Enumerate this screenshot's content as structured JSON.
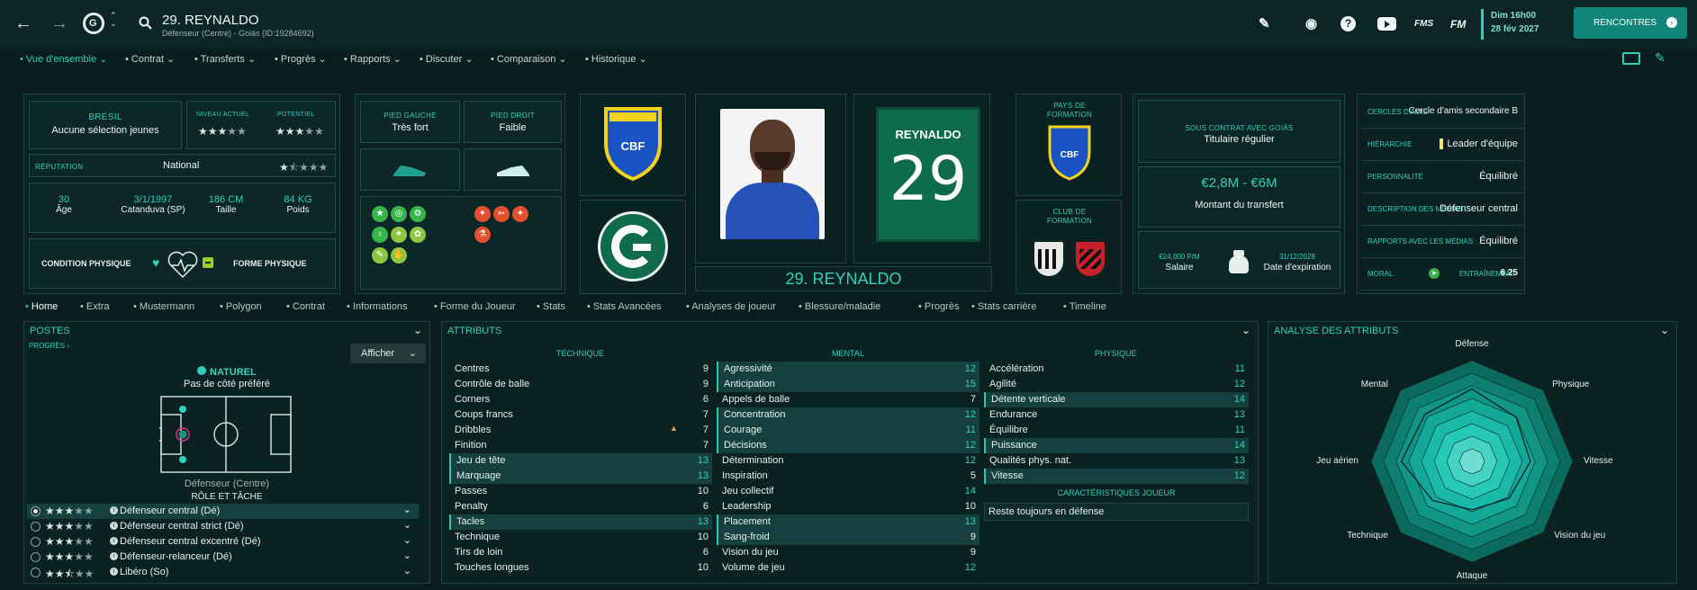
{
  "header": {
    "player_name": "29. REYNALDO",
    "subtitle": "Défenseur (Centre) - Goiás (ID:19284692)",
    "icons": [
      "back-arrow-icon",
      "forward-arrow-icon",
      "club-badge-icon",
      "search-icon",
      "edit-pencil-icon",
      "brain-icon",
      "help-icon",
      "youtube-icon",
      "fms-icon",
      "fm-icon"
    ],
    "fms_label": "FMS",
    "fm_label": "FM",
    "date_line1": "Dim 16h00",
    "date_line2": "28 fév 2027",
    "rencontres_label": "RENCONTRES"
  },
  "subnav": [
    "Vue d'ensemble",
    "Contrat",
    "Transferts",
    "Progrès",
    "Rapports",
    "Discuter",
    "Comparaison",
    "Historique"
  ],
  "overview": {
    "nation": "BRÉSIL",
    "nation_sub": "Aucune sélection jeunes",
    "niveau_label": "NIVEAU ACTUEL",
    "potentiel_label": "POTENTIEL",
    "niveau_stars": 3,
    "potentiel_stars": 3,
    "reputation_label": "RÉPUTATION",
    "reputation_value": "National",
    "reputation_stars": 1.5,
    "age": "30",
    "age_label": "Âge",
    "birth": "3/1/1997",
    "birth_label": "Catanduva (SP)",
    "height": "186 CM",
    "height_label": "Taille",
    "weight": "84 KG",
    "weight_label": "Poids",
    "condition_label": "CONDITION PHYSIQUE",
    "forme_label": "FORME PHYSIQUE",
    "pied_gauche_label": "PIED GAUCHE",
    "pied_gauche_value": "Très fort",
    "pied_droit_label": "PIED DROIT",
    "pied_droit_value": "Faible",
    "shirt_name": "REYNALDO",
    "shirt_number": "29",
    "banner_name": "29. REYNALDO",
    "cbf_label": "CBF",
    "pays_formation_label": "PAYS DE FORMATION",
    "club_formation_label": "CLUB DE FORMATION",
    "contract_label": "SOUS CONTRAT AVEC GOIÁS",
    "contract_value": "Titulaire régulier",
    "transfer_value": "€2,8M - €6M",
    "transfer_label": "Montant du transfert",
    "salary": "€24,000 P/M",
    "salary_label": "Salaire",
    "expiry": "31/12/2028",
    "expiry_label": "Date d'expiration"
  },
  "right_info": [
    {
      "k": "CERCLES D'AMIS",
      "v": "Cercle d'amis secondaire B"
    },
    {
      "k": "HIÉRARCHIE",
      "v": "Leader d'équipe"
    },
    {
      "k": "PERSONNALITÉ",
      "v": "Équilibré"
    },
    {
      "k": "DESCRIPTION DES MÉDIAS",
      "v": "Défenseur central"
    },
    {
      "k": "RAPPORTS AVEC LES MÉDIAS",
      "v": "Équilibré"
    },
    {
      "k": "MORAL",
      "v": ""
    }
  ],
  "moral_extra": {
    "k": "ENTRAÎNEMENT",
    "v": "6.25"
  },
  "tabs": [
    "Home",
    "Extra",
    "Mustermann",
    "Polygon",
    "Contrat",
    "Informations",
    "Forme du Joueur",
    "Stats",
    "Stats Avancées",
    "Analyses de joueur",
    "Blessure/maladie",
    "Progrès",
    "Stats carrière",
    "Timeline"
  ],
  "positions": {
    "title": "POSTES",
    "progres_link": "PROGRÈS",
    "afficher_label": "Afficher",
    "natural_label": "NATUREL",
    "side_label": "Pas de côté préféré",
    "position_label": "Défenseur (Centre)",
    "role_label": "RÔLE ET TÂCHE",
    "roles": [
      {
        "name": "Défenseur central (Dé)",
        "stars": 3
      },
      {
        "name": "Défenseur central strict (Dé)",
        "stars": 3
      },
      {
        "name": "Défenseur central excentré (Dé)",
        "stars": 3
      },
      {
        "name": "Défenseur-relanceur (Dé)",
        "stars": 3
      },
      {
        "name": "Libéro (So)",
        "stars": 2.5
      }
    ]
  },
  "attributes": {
    "title": "ATTRIBUTS",
    "technique_label": "TECHNIQUE",
    "mental_label": "MENTAL",
    "physique_label": "PHYSIQUE",
    "traits_label": "CARACTÉRISTIQUES JOUEUR",
    "trait": "Reste toujours en défense",
    "technique": [
      {
        "n": "Centres",
        "v": "9",
        "hl": false
      },
      {
        "n": "Contrôle de balle",
        "v": "9",
        "hl": false
      },
      {
        "n": "Corners",
        "v": "6",
        "hl": false
      },
      {
        "n": "Coups francs",
        "v": "7",
        "hl": false
      },
      {
        "n": "Dribbles",
        "v": "7",
        "hl": false
      },
      {
        "n": "Finition",
        "v": "7",
        "hl": false
      },
      {
        "n": "Jeu de tête",
        "v": "13",
        "hl": true
      },
      {
        "n": "Marquage",
        "v": "13",
        "hl": true
      },
      {
        "n": "Passes",
        "v": "10",
        "hl": false
      },
      {
        "n": "Penalty",
        "v": "6",
        "hl": false
      },
      {
        "n": "Tacles",
        "v": "13",
        "hl": true
      },
      {
        "n": "Technique",
        "v": "10",
        "hl": false
      },
      {
        "n": "Tirs de loin",
        "v": "6",
        "hl": false
      },
      {
        "n": "Touches longues",
        "v": "10",
        "hl": false
      }
    ],
    "mental": [
      {
        "n": "Agressivité",
        "v": "12",
        "hl": true
      },
      {
        "n": "Anticipation",
        "v": "15",
        "hl": true
      },
      {
        "n": "Appels de balle",
        "v": "7",
        "hl": false
      },
      {
        "n": "Concentration",
        "v": "12",
        "hl": true
      },
      {
        "n": "Courage",
        "v": "11",
        "hl": true
      },
      {
        "n": "Décisions",
        "v": "12",
        "hl": true
      },
      {
        "n": "Détermination",
        "v": "12",
        "hl": false
      },
      {
        "n": "Inspiration",
        "v": "5",
        "hl": false
      },
      {
        "n": "Jeu collectif",
        "v": "14",
        "hl": false
      },
      {
        "n": "Leadership",
        "v": "10",
        "hl": false
      },
      {
        "n": "Placement",
        "v": "13",
        "hl": true
      },
      {
        "n": "Sang-froid",
        "v": "9",
        "hl": true
      },
      {
        "n": "Vision du jeu",
        "v": "9",
        "hl": false
      },
      {
        "n": "Volume de jeu",
        "v": "12",
        "hl": false
      }
    ],
    "physique": [
      {
        "n": "Accélération",
        "v": "11",
        "hl": false
      },
      {
        "n": "Agilité",
        "v": "12",
        "hl": false
      },
      {
        "n": "Détente verticale",
        "v": "14",
        "hl": true
      },
      {
        "n": "Endurance",
        "v": "13",
        "hl": false
      },
      {
        "n": "Équilibre",
        "v": "11",
        "hl": false
      },
      {
        "n": "Puissance",
        "v": "14",
        "hl": true
      },
      {
        "n": "Qualités phys. nat.",
        "v": "13",
        "hl": false
      },
      {
        "n": "Vitesse",
        "v": "12",
        "hl": true
      }
    ]
  },
  "radar": {
    "title": "ANALYSE DES ATTRIBUTS",
    "labels": [
      "Défense",
      "Physique",
      "Vitesse",
      "Vision du jeu",
      "Attaque",
      "Technique",
      "Jeu aérien",
      "Mental"
    ],
    "values": [
      0.72,
      0.62,
      0.58,
      0.52,
      0.48,
      0.55,
      0.7,
      0.66
    ]
  },
  "colors": {
    "accent": "#2fd1bb",
    "bg": "#0a1e1f",
    "button": "#12857a"
  }
}
